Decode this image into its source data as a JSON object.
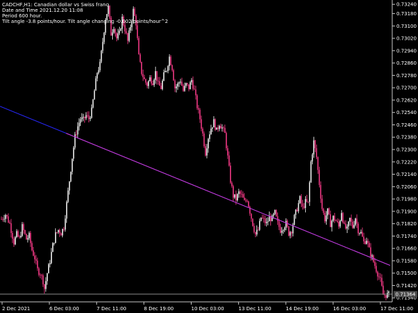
{
  "info": {
    "line1": "CADCHF,H1:  Canadian dollar vs Swiss franc",
    "line2": "Date and Time 2021.12.20 11:08",
    "line3": "Period       600 hour.",
    "line4": "Tilt angle -3.8 points/hour.  Tilt angle changing -0.002 points/hour^2"
  },
  "colors": {
    "background": "#000000",
    "bull_candle": "#ffffff",
    "bear_candle": "#ff3c8c",
    "trend_blue": "#2828ff",
    "trend_magenta": "#d23cd2",
    "current_price_line": "#8c8c8c",
    "price_tag_bg": "#4a4a4a",
    "axis": "#c8c8c8",
    "text": "#ffffff"
  },
  "price_tag": "0.71364",
  "chart_data": {
    "type": "candlestick",
    "symbol": "CADCHF",
    "timeframe": "H1",
    "y_ticks": [
      "0.73240",
      "0.73180",
      "0.73100",
      "0.73020",
      "0.72940",
      "0.72860",
      "0.72780",
      "0.72700",
      "0.72620",
      "0.72540",
      "0.72460",
      "0.72380",
      "0.72300",
      "0.72220",
      "0.72140",
      "0.72060",
      "0.71980",
      "0.71900",
      "0.71820",
      "0.71740",
      "0.71660",
      "0.71580",
      "0.71500",
      "0.71420",
      "0.71340"
    ],
    "x_ticks": [
      "2 Dec 2021",
      "6 Dec 03:00",
      "7 Dec 11:00",
      "8 Dec 19:00",
      "10 Dec 03:00",
      "13 Dec 11:00",
      "14 Dec 19:00",
      "16 Dec 03:00",
      "17 Dec 11:00"
    ],
    "ylim": [
      0.71314,
      0.73268
    ],
    "current_price": 0.71364,
    "trend_line": {
      "start": 0.7258,
      "end": 0.7155
    },
    "close_path": [
      [
        0,
        0.7185
      ],
      [
        3,
        0.7188
      ],
      [
        6,
        0.7182
      ],
      [
        9,
        0.717
      ],
      [
        11,
        0.7175
      ],
      [
        13,
        0.7172
      ],
      [
        15,
        0.718
      ],
      [
        18,
        0.7172
      ],
      [
        20,
        0.7174
      ],
      [
        22,
        0.7165
      ],
      [
        24,
        0.716
      ],
      [
        26,
        0.7152
      ],
      [
        28,
        0.715
      ],
      [
        30,
        0.7145
      ],
      [
        31,
        0.714
      ],
      [
        33,
        0.715
      ],
      [
        35,
        0.7158
      ],
      [
        37,
        0.7168
      ],
      [
        39,
        0.7175
      ],
      [
        41,
        0.7178
      ],
      [
        43,
        0.7176
      ],
      [
        45,
        0.718
      ],
      [
        47,
        0.7195
      ],
      [
        49,
        0.721
      ],
      [
        51,
        0.7225
      ],
      [
        53,
        0.7238
      ],
      [
        55,
        0.7245
      ],
      [
        57,
        0.725
      ],
      [
        59,
        0.7249
      ],
      [
        61,
        0.7252
      ],
      [
        63,
        0.725
      ],
      [
        65,
        0.7255
      ],
      [
        67,
        0.7268
      ],
      [
        69,
        0.728
      ],
      [
        71,
        0.7285
      ],
      [
        73,
        0.73
      ],
      [
        75,
        0.7315
      ],
      [
        77,
        0.7322
      ],
      [
        79,
        0.7305
      ],
      [
        81,
        0.731
      ],
      [
        83,
        0.7302
      ],
      [
        85,
        0.7305
      ],
      [
        87,
        0.7315
      ],
      [
        89,
        0.7308
      ],
      [
        91,
        0.73
      ],
      [
        93,
        0.731
      ],
      [
        95,
        0.732
      ],
      [
        97,
        0.7312
      ],
      [
        99,
        0.729
      ],
      [
        101,
        0.728
      ],
      [
        103,
        0.7275
      ],
      [
        105,
        0.7272
      ],
      [
        107,
        0.7276
      ],
      [
        109,
        0.7274
      ],
      [
        111,
        0.728
      ],
      [
        113,
        0.7272
      ],
      [
        115,
        0.727
      ],
      [
        117,
        0.7278
      ],
      [
        119,
        0.7282
      ],
      [
        121,
        0.729
      ],
      [
        123,
        0.7283
      ],
      [
        125,
        0.727
      ],
      [
        127,
        0.7272
      ],
      [
        129,
        0.7275
      ],
      [
        131,
        0.7268
      ],
      [
        133,
        0.7272
      ],
      [
        135,
        0.727
      ],
      [
        137,
        0.7275
      ],
      [
        139,
        0.7268
      ],
      [
        141,
        0.7258
      ],
      [
        143,
        0.725
      ],
      [
        145,
        0.724
      ],
      [
        147,
        0.7228
      ],
      [
        149,
        0.7238
      ],
      [
        151,
        0.7244
      ],
      [
        153,
        0.7248
      ],
      [
        155,
        0.7242
      ],
      [
        157,
        0.7247
      ],
      [
        159,
        0.7244
      ],
      [
        161,
        0.724
      ],
      [
        163,
        0.7225
      ],
      [
        165,
        0.721
      ],
      [
        167,
        0.72
      ],
      [
        169,
        0.7198
      ],
      [
        171,
        0.7202
      ],
      [
        173,
        0.72
      ],
      [
        175,
        0.7196
      ],
      [
        177,
        0.7198
      ],
      [
        179,
        0.719
      ],
      [
        181,
        0.7182
      ],
      [
        183,
        0.7175
      ],
      [
        185,
        0.7178
      ],
      [
        187,
        0.7186
      ],
      [
        189,
        0.7184
      ],
      [
        191,
        0.7182
      ],
      [
        193,
        0.7186
      ],
      [
        195,
        0.7185
      ],
      [
        197,
        0.7189
      ],
      [
        199,
        0.7182
      ],
      [
        201,
        0.7178
      ],
      [
        203,
        0.718
      ],
      [
        205,
        0.7182
      ],
      [
        207,
        0.7176
      ],
      [
        209,
        0.7178
      ],
      [
        211,
        0.7186
      ],
      [
        213,
        0.7192
      ],
      [
        215,
        0.7198
      ],
      [
        217,
        0.7192
      ],
      [
        219,
        0.7196
      ],
      [
        221,
        0.7195
      ],
      [
        223,
        0.7222
      ],
      [
        225,
        0.7235
      ],
      [
        227,
        0.7225
      ],
      [
        229,
        0.7208
      ],
      [
        231,
        0.7192
      ],
      [
        233,
        0.7185
      ],
      [
        235,
        0.719
      ],
      [
        237,
        0.7182
      ],
      [
        239,
        0.7186
      ],
      [
        241,
        0.7184
      ],
      [
        243,
        0.718
      ],
      [
        245,
        0.719
      ],
      [
        247,
        0.718
      ],
      [
        249,
        0.7178
      ],
      [
        251,
        0.7185
      ],
      [
        253,
        0.718
      ],
      [
        255,
        0.7186
      ],
      [
        257,
        0.7178
      ],
      [
        259,
        0.7176
      ],
      [
        261,
        0.717
      ],
      [
        263,
        0.7172
      ],
      [
        265,
        0.7165
      ],
      [
        267,
        0.716
      ],
      [
        269,
        0.7155
      ],
      [
        271,
        0.715
      ],
      [
        273,
        0.7145
      ],
      [
        275,
        0.7136
      ]
    ]
  }
}
